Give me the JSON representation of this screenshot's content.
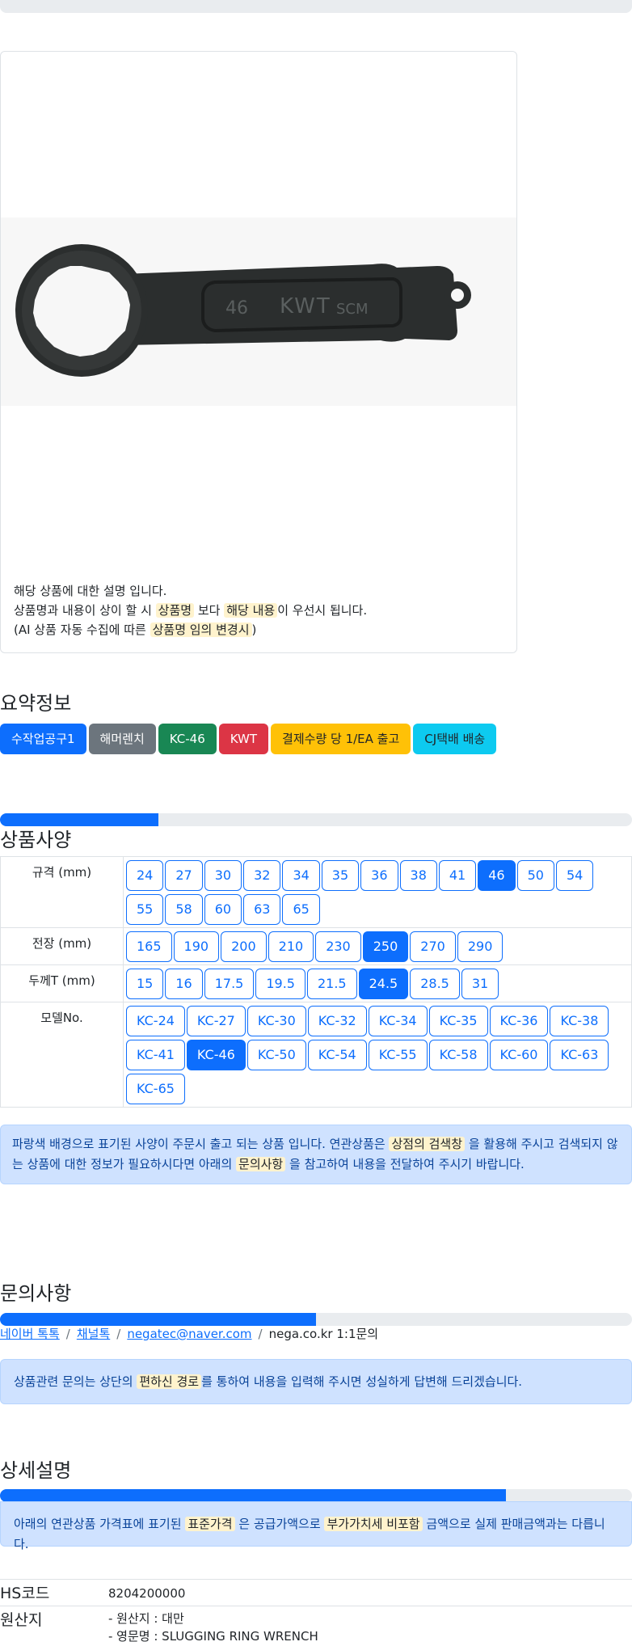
{
  "product": {
    "notes": {
      "line1": "해당 상품에 대한 설명 입니다.",
      "line2_a": "상품명과 내용이 상이 할 시",
      "line2_mark1": "상품명",
      "line2_b": "보다",
      "line2_mark2": "해당 내용",
      "line2_c": "이 우선시 됩니다.",
      "line3_a": "(AI 상품 자동 수집에 따른",
      "line3_mark": "상품명 임의 변경시",
      "line3_b": ")"
    },
    "image_text": {
      "size": "46",
      "brand": "KWT",
      "material": "SCM"
    }
  },
  "summary": {
    "title": "요약정보",
    "badges": [
      {
        "label": "수작업공구1",
        "color": "#0d6efd"
      },
      {
        "label": "해머렌치",
        "color": "#6c757d"
      },
      {
        "label": "KC-46",
        "color": "#198754"
      },
      {
        "label": "KWT",
        "color": "#dc3545"
      },
      {
        "label": "결제수량 당 1/EA 출고",
        "color": "#ffc107",
        "text_color": "#212529"
      },
      {
        "label": "CJ택배 배송",
        "color": "#0dcaf0",
        "text_color": "#212529"
      }
    ]
  },
  "specs": {
    "title": "상품사양",
    "progress": 0.25,
    "rows": [
      {
        "label": "규격 (mm)",
        "values": [
          "24",
          "27",
          "30",
          "32",
          "34",
          "35",
          "36",
          "38",
          "41",
          "46",
          "50",
          "54",
          "55",
          "58",
          "60",
          "63",
          "65"
        ],
        "selected": "46"
      },
      {
        "label": "전장 (mm)",
        "values": [
          "165",
          "190",
          "200",
          "210",
          "230",
          "250",
          "270",
          "290"
        ],
        "selected": "250"
      },
      {
        "label": "두께T (mm)",
        "values": [
          "15",
          "16",
          "17.5",
          "19.5",
          "21.5",
          "24.5",
          "28.5",
          "31"
        ],
        "selected": "24.5"
      },
      {
        "label": "모델No.",
        "values": [
          "KC-24",
          "KC-27",
          "KC-30",
          "KC-32",
          "KC-34",
          "KC-35",
          "KC-36",
          "KC-38",
          "KC-41",
          "KC-46",
          "KC-50",
          "KC-54",
          "KC-55",
          "KC-58",
          "KC-60",
          "KC-63",
          "KC-65"
        ],
        "selected": "KC-46"
      }
    ],
    "notice": {
      "a": "파랑색 배경으로 표기된 사양이 주문시 출고 되는 상품 입니다. 연관상품은",
      "mark1": "상점의 검색창",
      "b": "을 활용해 주시고 검색되지 않는 상품에 대한 정보가 필요하시다면 아래의",
      "mark2": "문의사항",
      "c": "을 참고하여 내용을 전달하여 주시기 바랍니다."
    }
  },
  "inquiry": {
    "title": "문의사항",
    "progress": 0.5,
    "links": [
      "네이버 톡톡",
      "채널톡",
      "negatec@naver.com"
    ],
    "plain": "nega.co.kr 1:1문의",
    "notice": {
      "a": "상품관련 문의는 상단의",
      "mark": "편하신 경로",
      "b": "를 통하여 내용을 입력해 주시면 성실하게 답변해 드리겠습니다."
    }
  },
  "detail": {
    "title": "상세설명",
    "progress": 0.8,
    "notice": {
      "a": "아래의 연관상품 가격표에 표기된",
      "mark1": "표준가격",
      "b": "은 공급가액으로",
      "mark2": "부가가치세 비포함",
      "c": "금액으로 실제 판매금액과는 다릅니다."
    },
    "hs": {
      "key": "HS코드",
      "value": "8204200000"
    },
    "origin": {
      "key": "원산지",
      "line1": "- 원산지 : 대만",
      "line2": "- 영문명 : SLUGGING RING WRENCH"
    }
  }
}
